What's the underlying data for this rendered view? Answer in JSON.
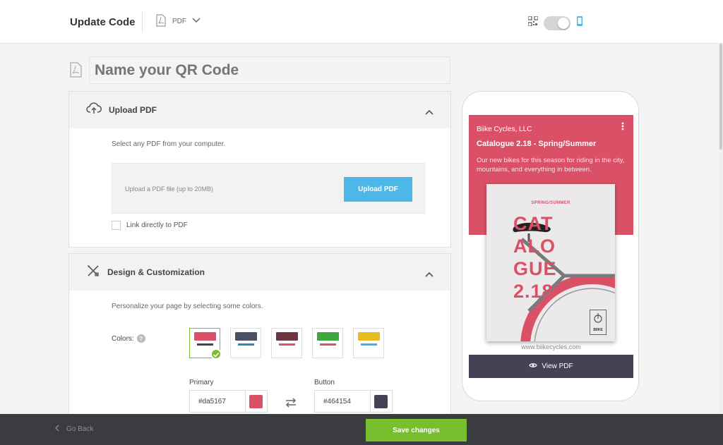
{
  "header": {
    "title": "Update Code",
    "file_type": "PDF",
    "qr_icon": "qr-code-icon",
    "mobile_icon": "mobile-phone-icon"
  },
  "name_field": {
    "placeholder": "Name your QR Code",
    "icon": "pdf-file-icon"
  },
  "upload_panel": {
    "title": "Upload PDF",
    "icon": "cloud-upload-icon",
    "description": "Select any PDF from your computer.",
    "hint": "Upload a PDF file (up to 20MB)",
    "button_label": "Upload PDF",
    "checkbox_label": "Link directly to PDF",
    "checkbox_checked": false
  },
  "design_panel": {
    "title": "Design & Customization",
    "icon": "design-tools-icon",
    "description": "Personalize your page by selecting some colors.",
    "colors_label": "Colors:",
    "selected_swatch": 0,
    "swatches": [
      {
        "top": "#da5167",
        "bottom": "#464154"
      },
      {
        "top": "#4a4f63",
        "bottom": "#2288d0"
      },
      {
        "top": "#6e3540",
        "bottom": "#da5167"
      },
      {
        "top": "#3ea63e",
        "bottom": "#da5167"
      },
      {
        "top": "#e6bb1d",
        "bottom": "#3fb1e0"
      }
    ],
    "primary_label": "Primary",
    "primary_value": "#da5167",
    "button_label": "Button",
    "button_value": "#464154"
  },
  "preview": {
    "company": "Biike Cycles, LLC",
    "title": "Catalogue 2.18 - Spring/Summer",
    "description": "Our new bikes for this season for riding in the city, mountains, and everything in between.",
    "cover_subtitle": "SPRING/SUMMER",
    "cover_lines": [
      "CAT",
      "ALO",
      "GUE",
      "2.18"
    ],
    "cover_logo": "BIIKE",
    "url": "www.biikecycles.com",
    "view_label": "View PDF",
    "hero_color": "#da5167",
    "bar_color": "#464154"
  },
  "footer": {
    "back_label": "Go Back",
    "save_label": "Save changes"
  }
}
